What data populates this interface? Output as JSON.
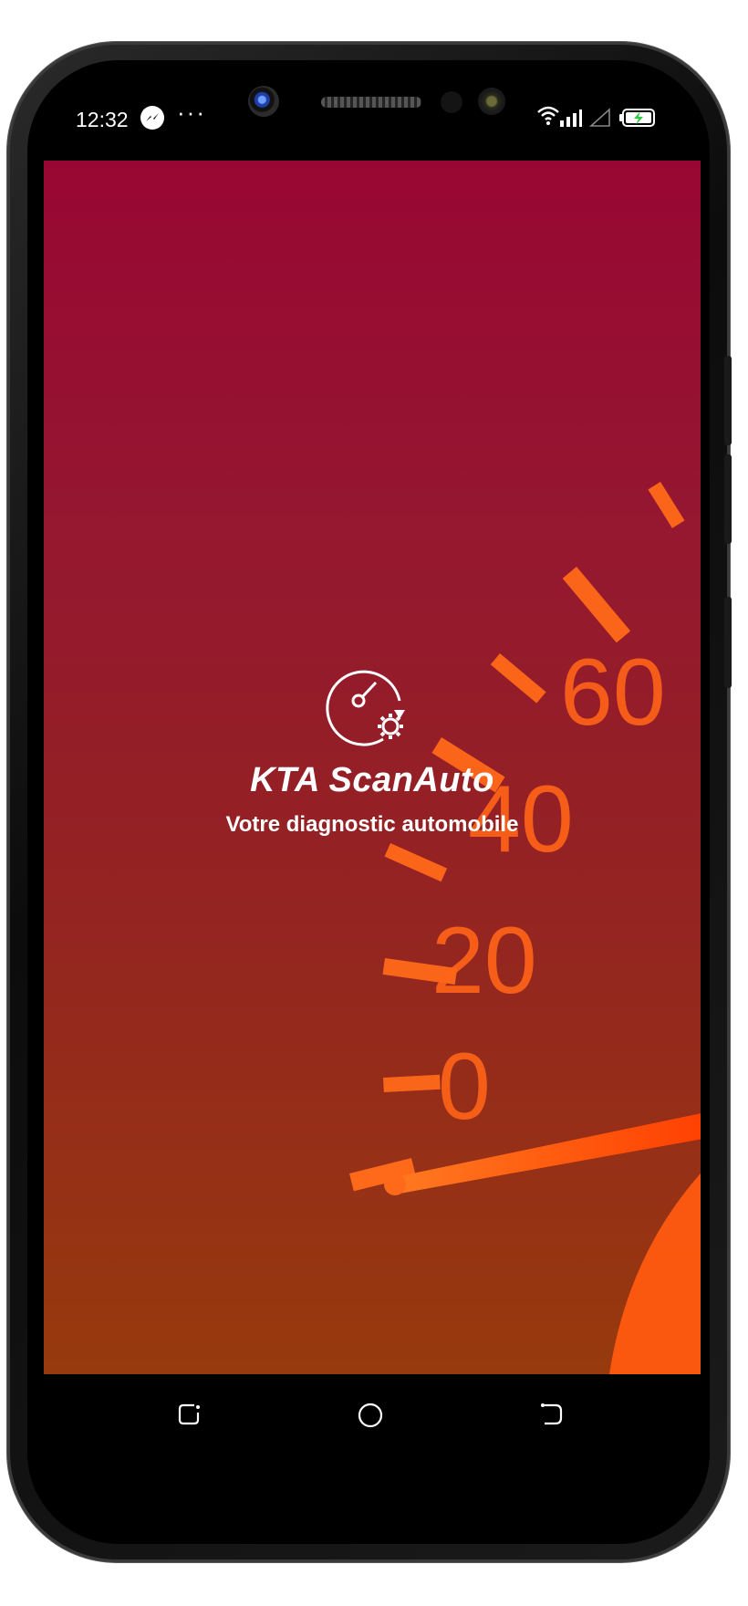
{
  "status_bar": {
    "time": "12:32",
    "notification_icon": "messenger-icon",
    "more_indicator": "···",
    "icons": [
      "wifi-icon",
      "signal-icon",
      "signal-empty-icon",
      "battery-charging-icon"
    ]
  },
  "splash": {
    "app_name": "KTA ScanAuto",
    "tagline": "Votre diagnostic automobile",
    "logo_icon": "gauge-gear-icon"
  },
  "background": {
    "gauge_labels": [
      "0",
      "20",
      "40",
      "60"
    ],
    "colors": {
      "top": "#980733",
      "bottom": "#973a0d",
      "gauge": "#ff6418"
    }
  },
  "nav_bar": {
    "icons": [
      "recent-apps-icon",
      "home-icon",
      "back-icon"
    ]
  }
}
